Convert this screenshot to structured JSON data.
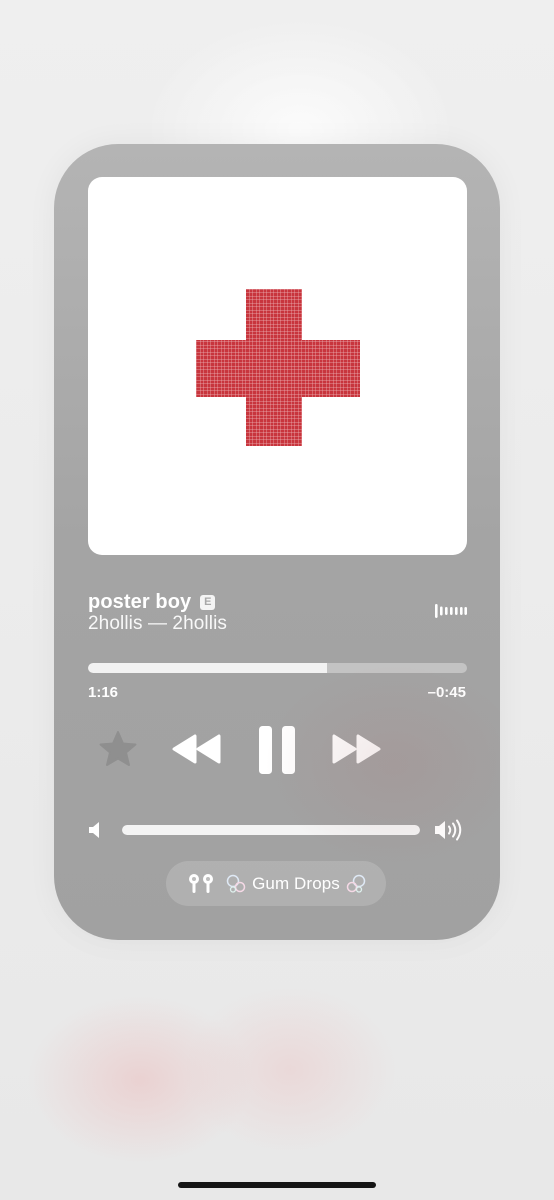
{
  "now_playing": {
    "title": "poster boy",
    "explicit_label": "E",
    "artist_album": "2hollis — 2hollis",
    "progress": 0.63,
    "elapsed": "1:16",
    "remaining": "–0:45",
    "volume": 1.0
  },
  "output_device": {
    "name": "Gum Drops",
    "icon": "airpods-icon",
    "decoration_icon": "bubbles-icon"
  },
  "controls": {
    "favorite_icon": "star-icon",
    "previous_icon": "rewind-icon",
    "play_state_icon": "pause-icon",
    "next_icon": "fast-forward-icon"
  },
  "colors": {
    "card_background": "#a8a8a8",
    "album_cross": "#c8353d",
    "text": "#ffffff"
  }
}
